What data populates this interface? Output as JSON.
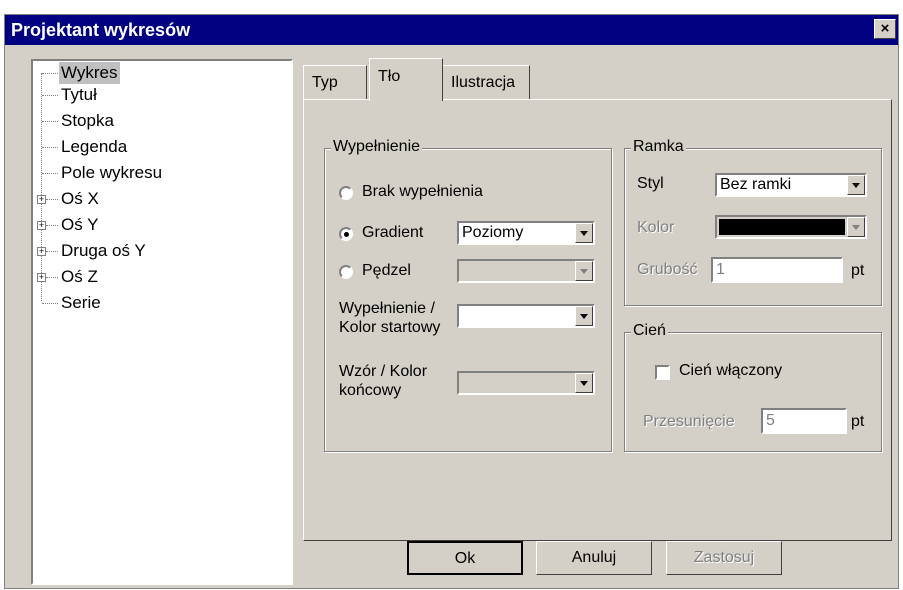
{
  "window": {
    "title": "Projektant wykresów",
    "close_label": "×"
  },
  "tree": {
    "items": [
      {
        "label": "Wykres",
        "selected": true
      },
      {
        "label": "Tytuł"
      },
      {
        "label": "Stopka"
      },
      {
        "label": "Legenda"
      },
      {
        "label": "Pole wykresu"
      },
      {
        "label": "Oś X",
        "expandable": true
      },
      {
        "label": "Oś Y",
        "expandable": true
      },
      {
        "label": "Druga oś Y",
        "expandable": true
      },
      {
        "label": "Oś Z",
        "expandable": true
      },
      {
        "label": "Serie"
      }
    ]
  },
  "tabs": [
    {
      "label": "Typ"
    },
    {
      "label": "Tło",
      "active": true
    },
    {
      "label": "Ilustracja"
    }
  ],
  "fill_group": {
    "title": "Wypełnienie",
    "options": [
      {
        "label": "Brak wypełnienia",
        "checked": false
      },
      {
        "label": "Gradient",
        "checked": true
      },
      {
        "label": "Pędzel",
        "checked": false
      }
    ],
    "gradient_value": "Poziomy",
    "brush_value": "",
    "start_color_label_1": "Wypełnienie /",
    "start_color_label_2": "Kolor startowy",
    "end_color_label_1": "Wzór / Kolor",
    "end_color_label_2": "końcowy"
  },
  "frame_group": {
    "title": "Ramka",
    "style_label": "Styl",
    "style_value": "Bez ramki",
    "color_label": "Kolor",
    "color_value": "#000000",
    "thickness_label": "Grubość",
    "thickness_value": "1",
    "thickness_unit": "pt"
  },
  "shadow_group": {
    "title": "Cień",
    "enabled_label": "Cień włączony",
    "enabled": false,
    "offset_label": "Przesunięcie",
    "offset_value": "5",
    "offset_unit": "pt"
  },
  "buttons": {
    "ok": "Ok",
    "cancel": "Anuluj",
    "apply": "Zastosuj"
  }
}
